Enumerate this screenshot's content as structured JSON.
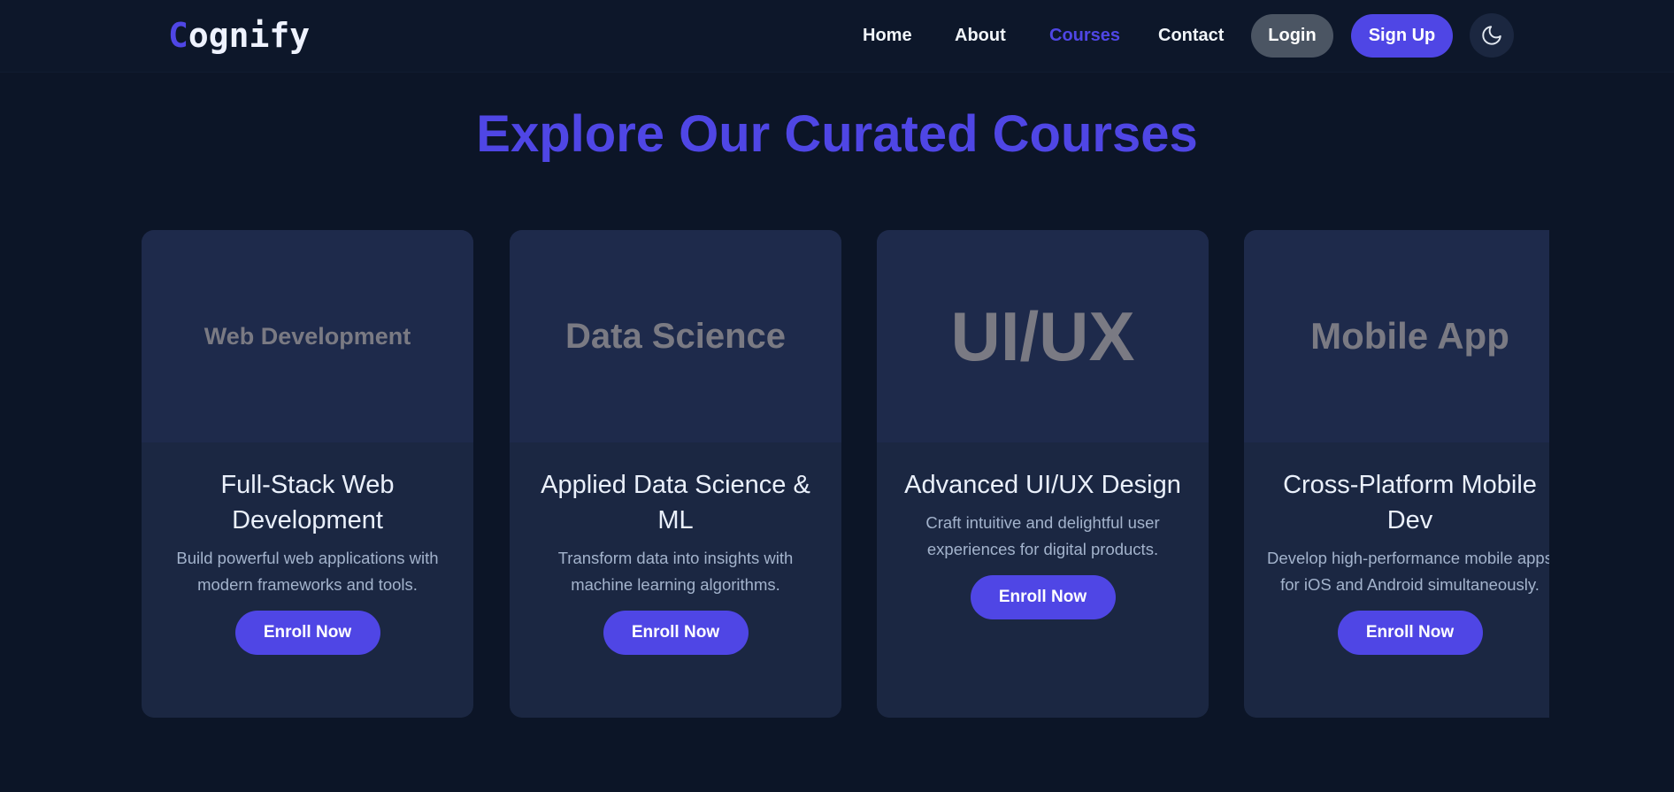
{
  "brand": {
    "logo_first": "C",
    "logo_rest": "ognify",
    "accent_color": "#4f46e5"
  },
  "nav": {
    "links": [
      {
        "label": "Home",
        "active": false
      },
      {
        "label": "About",
        "active": false
      },
      {
        "label": "Courses",
        "active": true
      },
      {
        "label": "Contact",
        "active": false
      }
    ],
    "login_label": "Login",
    "signup_label": "Sign Up",
    "theme_icon": "moon-icon"
  },
  "page": {
    "title": "Explore Our Curated Courses"
  },
  "courses": [
    {
      "image_label": "Web Development",
      "title": "Full-Stack Web Development",
      "description": "Build powerful web applications with modern frameworks and tools.",
      "button": "Enroll Now"
    },
    {
      "image_label": "Data Science",
      "title": "Applied Data Science & ML",
      "description": "Transform data into insights with machine learning algorithms.",
      "button": "Enroll Now"
    },
    {
      "image_label": "UI/UX",
      "title": "Advanced UI/UX Design",
      "description": "Craft intuitive and delightful user experiences for digital products.",
      "button": "Enroll Now"
    },
    {
      "image_label": "Mobile App",
      "title": "Cross-Platform Mobile Dev",
      "description": "Develop high-performance mobile apps for iOS and Android simultaneously.",
      "button": "Enroll Now"
    }
  ]
}
